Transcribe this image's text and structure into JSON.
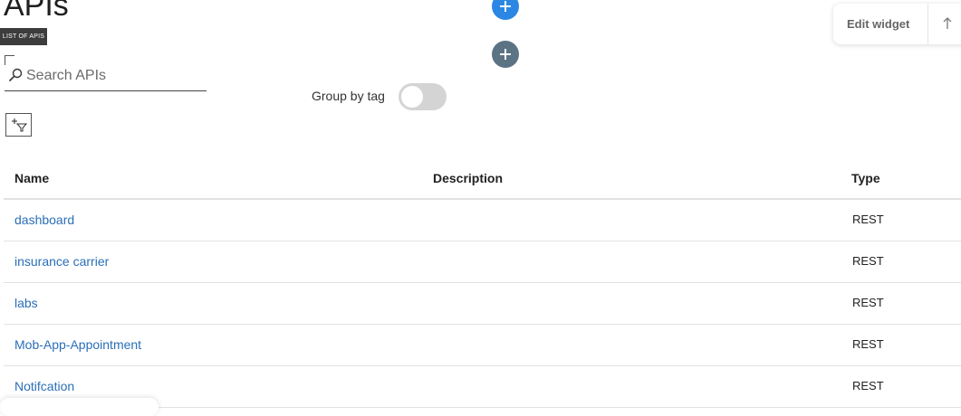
{
  "page": {
    "title": "APIs",
    "section_tag": "LIST OF APIS"
  },
  "search": {
    "placeholder": "Search APIs",
    "value": ""
  },
  "actions": {
    "add_primary_icon": "plus-icon",
    "add_secondary_icon": "plus-icon",
    "filter_icon": "add-filter-icon"
  },
  "group_by_tag": {
    "label": "Group by tag",
    "enabled": false
  },
  "edit_widget": {
    "label": "Edit widget",
    "icon": "arrow-up-icon"
  },
  "table": {
    "columns": [
      "Name",
      "Description",
      "Type"
    ],
    "rows": [
      {
        "name": "dashboard",
        "description": "",
        "type": "REST"
      },
      {
        "name": "insurance carrier",
        "description": "",
        "type": "REST"
      },
      {
        "name": "labs",
        "description": "",
        "type": "REST"
      },
      {
        "name": "Mob-App-Appointment",
        "description": "",
        "type": "REST"
      },
      {
        "name": "Notifcation",
        "description": "",
        "type": "REST"
      }
    ]
  },
  "colors": {
    "link": "#2a6fb8",
    "primary_button": "#2b87e3",
    "secondary_button": "#5c7384",
    "toggle_off": "#d4d4d4"
  }
}
